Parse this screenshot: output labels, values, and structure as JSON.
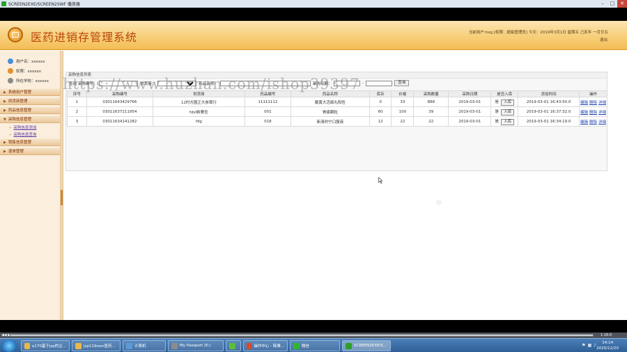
{
  "player": {
    "title": "SCREEN2EXE/SCREEN2SWF 播放器",
    "time": "1:16:0",
    "controls": "◀◀ ▶"
  },
  "header": {
    "app_title": "医药进销存管理系统",
    "user_info": "当前用户:hxg [权限：超级管理员] 今天：2019年3月1日 星期五 己亥年 一月廿五",
    "logout": "退出"
  },
  "sidebar": {
    "user": [
      {
        "label": "用户名：xxxxxx",
        "color": "#4a8fd8"
      },
      {
        "label": "权限：xxxxxx",
        "color": "#e2902a"
      },
      {
        "label": "所在学校：xxxxxx",
        "color": "#8a8a8a"
      }
    ],
    "menu": [
      {
        "label": "系统用户管理"
      },
      {
        "label": "供货商管理"
      },
      {
        "label": "药品信息管理"
      },
      {
        "label": "采购信息管理"
      }
    ],
    "submenu": [
      {
        "label": "采购信息添加"
      },
      {
        "label": "采购信息查询"
      }
    ],
    "menu_after": [
      {
        "label": "销售信息管理"
      },
      {
        "label": "退单管理"
      }
    ]
  },
  "panel": {
    "header": "采购信息列表",
    "search_label_1": "查询  采购编号：",
    "search_label_2": "供货商：",
    "search_label_3": "药品名称：",
    "search_label_4": "采购日期：",
    "search_button": "查询"
  },
  "table": {
    "columns": [
      "序号",
      "采购编号",
      "供货商",
      "药品编号",
      "药品名称",
      "库存",
      "价格",
      "采购数量",
      "采购日期",
      "是否入库",
      "添加时间",
      "操作"
    ],
    "rows": [
      {
        "idx": "1",
        "code": "03011643429766",
        "supplier": "12时方圆正大参茸行",
        "drug_code": "11111112",
        "drug_name": "藤黄大活络丸阳性",
        "stock": "0",
        "price": "33",
        "qty": "888",
        "date": "2019-03-01",
        "in_status": "是",
        "in_btn": "入库",
        "added": "2019-03-01 16:43:50.0"
      },
      {
        "idx": "2",
        "code": "03011637211954",
        "supplier": "fdsf新赛圣",
        "drug_code": "001",
        "drug_name": "胃痛颗粒",
        "stock": "60",
        "price": "100",
        "qty": "39",
        "date": "2019-03-01",
        "in_status": "是",
        "in_btn": "入库",
        "added": "2019-03-01 16:37:32.0"
      },
      {
        "idx": "3",
        "code": "03011634141282",
        "supplier": "fdg",
        "drug_code": "018",
        "drug_name": "新清时宁口服液",
        "stock": "12",
        "price": "22",
        "qty": "22",
        "date": "2019-03-01",
        "in_status": "是",
        "in_btn": "入库",
        "added": "2019-03-01 16:34:19.0"
      }
    ],
    "actions": [
      "编辑",
      "删除",
      "详细"
    ]
  },
  "watermark": "https://www.huzhan.com/ishop39397",
  "taskbar": {
    "items": [
      {
        "label": "a170基于jsp的企...",
        "color": "#e8b84a"
      },
      {
        "label": "jsp119ssm医药...",
        "color": "#e8b84a"
      },
      {
        "label": "计算机",
        "color": "#5a9bd8"
      },
      {
        "label": "My Passport (E:)",
        "color": "#8c8c8c"
      },
      {
        "label": "",
        "color": "#5bbf3a"
      },
      {
        "label": "操作中心 - 韩雅...",
        "color": "#d84a2a"
      },
      {
        "label": "微信",
        "color": "#2fb82f"
      },
      {
        "label": "SCREEN2EXE/S...",
        "color": "#2aa02a"
      }
    ],
    "clock_time": "14:14",
    "clock_date": "2020/12/20"
  }
}
